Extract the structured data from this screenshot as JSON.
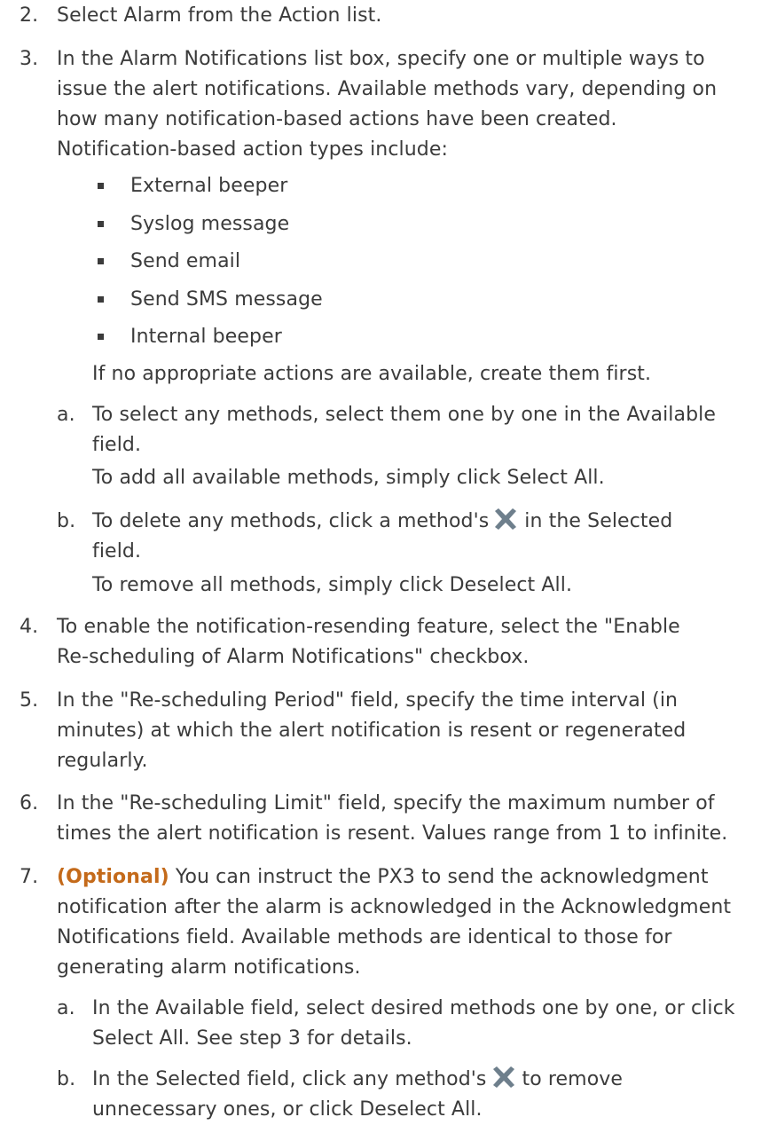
{
  "steps": [
    {
      "num": "2.",
      "lines": [
        "Select Alarm from the Action list."
      ]
    },
    {
      "num": "3.",
      "lines": [
        "In the Alarm Notifications list box, specify one or multiple ways to",
        "issue the alert notifications. Available methods vary, depending on",
        "how many notification-based actions have been created.",
        "Notification-based action types include:"
      ]
    },
    {
      "num": "4.",
      "lines": [
        "To enable the notification-resending feature, select the \"Enable",
        "Re-scheduling of Alarm Notifications\" checkbox."
      ]
    },
    {
      "num": "5.",
      "lines": [
        "In the \"Re-scheduling Period\" field, specify the time interval (in",
        "minutes) at which the alert notification is resent or regenerated",
        "regularly."
      ]
    },
    {
      "num": "6.",
      "lines": [
        "In the \"Re-scheduling Limit\" field, specify the maximum number of",
        "times the alert notification is resent. Values range from 1 to infinite."
      ]
    },
    {
      "num": "7.",
      "optional_label": "(Optional)",
      "lines": [
        " You can instruct the PX3 to send the acknowledgment",
        "notification after the alarm is acknowledged in the Acknowledgment",
        "Notifications field. Available methods are identical to those for",
        "generating alarm notifications."
      ]
    }
  ],
  "bullets": [
    "External beeper",
    "Syslog message",
    "Send email",
    "Send SMS message",
    "Internal beeper"
  ],
  "after_bullets": "If no appropriate actions are available, create them first.",
  "step3_sub": [
    {
      "letter": "a.",
      "lines": [
        "To select any methods, select them one by one in the Available",
        "field."
      ],
      "note": "To add all available methods, simply click Select All."
    },
    {
      "letter": "b.",
      "pre": "To delete any methods, click a method's",
      "post": "in the Selected",
      "lines2": "field.",
      "note": "To remove all methods, simply click Deselect All."
    }
  ],
  "step7_sub": [
    {
      "letter": "a.",
      "lines": [
        "In the Available field, select desired methods one by one, or click",
        "Select All. See step 3 for details."
      ]
    },
    {
      "letter": "b.",
      "pre": "In the Selected field, click any method's",
      "post": "to remove",
      "lines2": "unnecessary ones, or click Deselect All."
    }
  ],
  "icon": "close-x-icon",
  "colors": {
    "text": "#3b3b3b",
    "optional": "#c46a1a",
    "icon": "#6e7f8c"
  }
}
